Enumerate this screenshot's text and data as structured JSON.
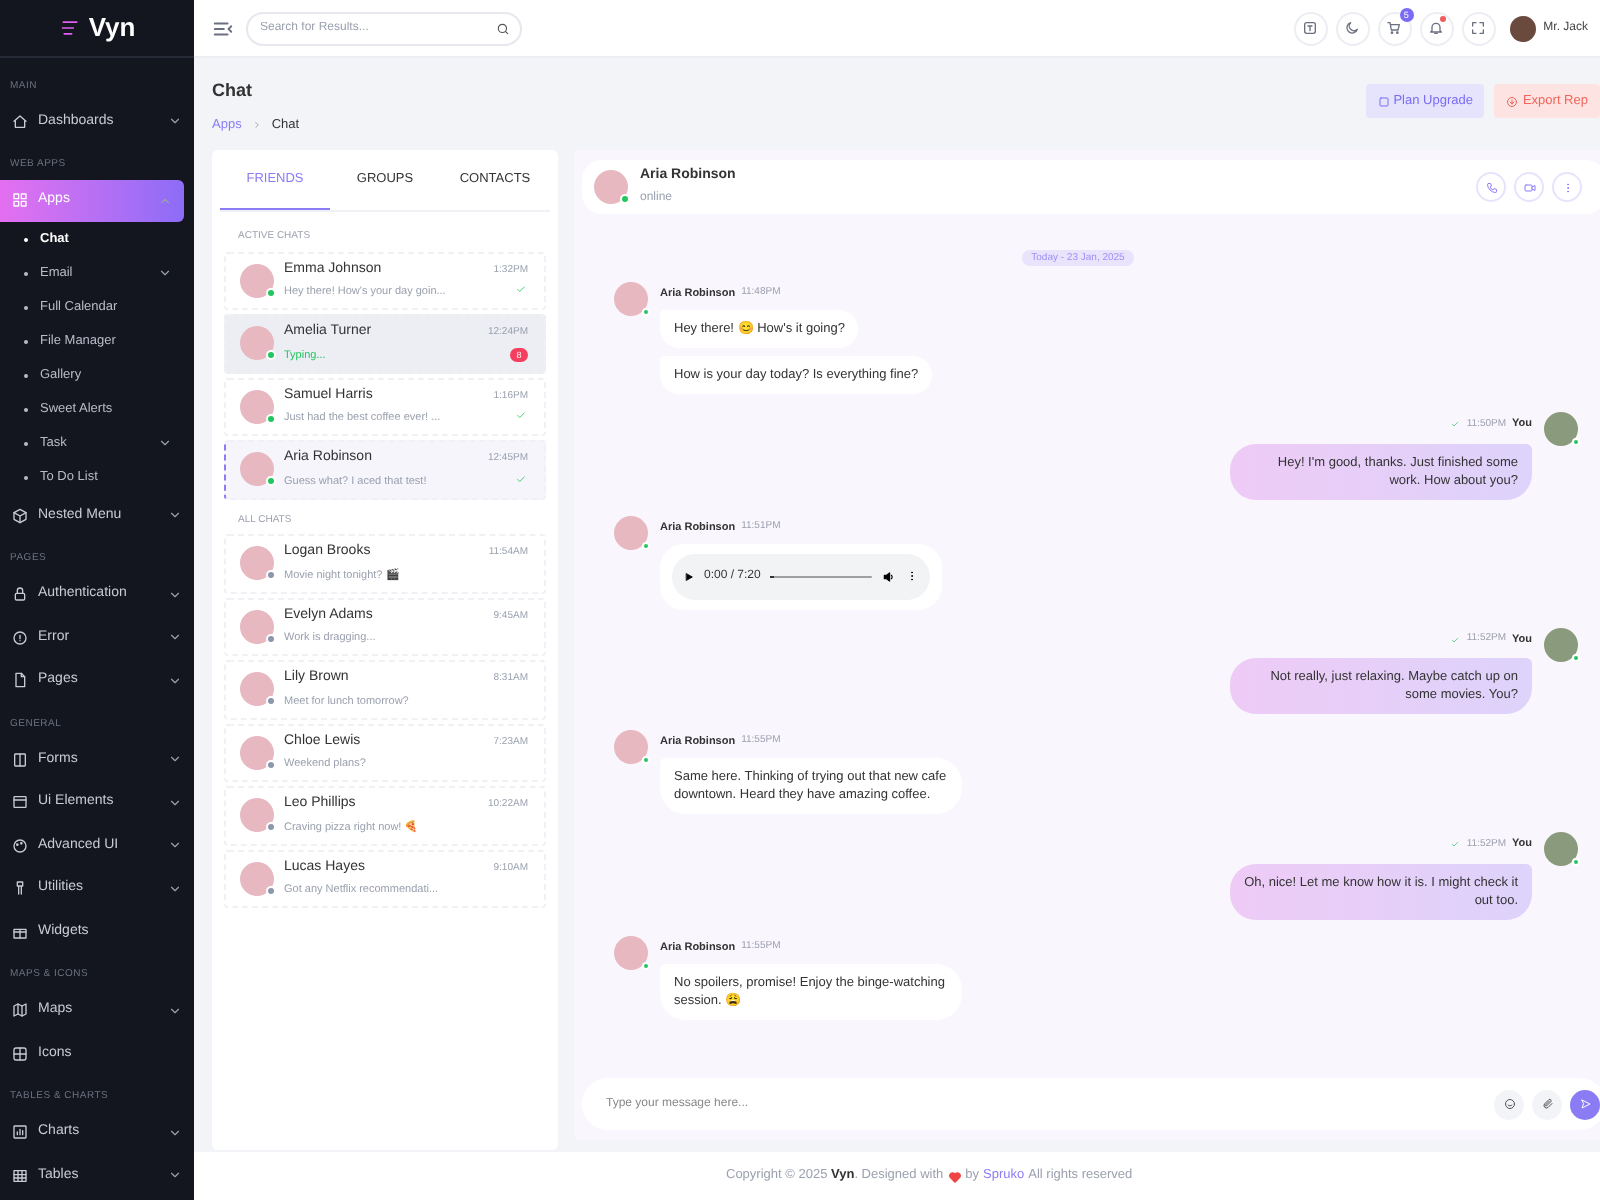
{
  "brand": "Vyn",
  "sidebar": {
    "sections": [
      {
        "label": "MAIN",
        "items": [
          {
            "label": "Dashboards",
            "has_submenu": true,
            "expanded": false,
            "selected": false
          }
        ]
      },
      {
        "label": "WEB APPS",
        "items": [
          {
            "label": "Apps",
            "has_submenu": true,
            "expanded": true,
            "selected": true,
            "children": [
              {
                "label": "Chat",
                "has_submenu": false,
                "selected": true
              },
              {
                "label": "Email",
                "has_submenu": true,
                "selected": false
              },
              {
                "label": "Full Calendar",
                "has_submenu": false,
                "selected": false
              },
              {
                "label": "File Manager",
                "has_submenu": false,
                "selected": false
              },
              {
                "label": "Gallery",
                "has_submenu": false,
                "selected": false
              },
              {
                "label": "Sweet Alerts",
                "has_submenu": false,
                "selected": false
              },
              {
                "label": "Task",
                "has_submenu": true,
                "selected": false
              },
              {
                "label": "To Do List",
                "has_submenu": false,
                "selected": false
              }
            ]
          },
          {
            "label": "Nested Menu",
            "has_submenu": true,
            "expanded": false,
            "selected": false
          }
        ]
      },
      {
        "label": "PAGES",
        "items": [
          {
            "label": "Authentication",
            "has_submenu": true,
            "expanded": false,
            "selected": false
          },
          {
            "label": "Error",
            "has_submenu": true,
            "expanded": false,
            "selected": false
          },
          {
            "label": "Pages",
            "has_submenu": true,
            "expanded": false,
            "selected": false
          }
        ]
      },
      {
        "label": "GENERAL",
        "items": [
          {
            "label": "Forms",
            "has_submenu": true,
            "expanded": false,
            "selected": false
          },
          {
            "label": "Ui Elements",
            "has_submenu": true,
            "expanded": false,
            "selected": false
          },
          {
            "label": "Advanced UI",
            "has_submenu": true,
            "expanded": false,
            "selected": false
          },
          {
            "label": "Utilities",
            "has_submenu": true,
            "expanded": false,
            "selected": false
          },
          {
            "label": "Widgets",
            "has_submenu": false,
            "selected": false
          }
        ]
      },
      {
        "label": "MAPS & ICONS",
        "items": [
          {
            "label": "Maps",
            "has_submenu": true,
            "expanded": false,
            "selected": false
          },
          {
            "label": "Icons",
            "has_submenu": false,
            "selected": false
          }
        ]
      },
      {
        "label": "TABLES & CHARTS",
        "items": [
          {
            "label": "Charts",
            "has_submenu": true,
            "expanded": false,
            "selected": false
          },
          {
            "label": "Tables",
            "has_submenu": true,
            "expanded": false,
            "selected": false
          }
        ]
      }
    ]
  },
  "header": {
    "search": {
      "placeholder": "Search for Results..."
    },
    "cart_count": "5",
    "notifications_unread": true,
    "user": "Mr. Jack"
  },
  "page": {
    "title": "Chat",
    "breadcrumb": [
      "Apps",
      "Chat"
    ],
    "buttons": [
      {
        "label": "Plan Upgrade",
        "kind": "primary"
      },
      {
        "label": "Export Rep",
        "kind": "danger"
      }
    ]
  },
  "chat_list": {
    "tabs": [
      {
        "label": "FRIENDS",
        "selected": true
      },
      {
        "label": "GROUPS",
        "selected": false
      },
      {
        "label": "CONTACTS",
        "selected": false
      }
    ],
    "groups": [
      {
        "label": "ACTIVE CHATS",
        "chats": [
          {
            "name": "Emma Johnson",
            "message": "Hey there! How's your day goin...",
            "time": "1:32PM",
            "online": true,
            "typing": false,
            "read": true,
            "highlighted": false,
            "selected": false
          },
          {
            "name": "Amelia Turner",
            "message": "Typing...",
            "time": "12:24PM",
            "online": true,
            "typing": true,
            "read": false,
            "unread": "8",
            "highlighted": true,
            "selected": false
          },
          {
            "name": "Samuel Harris",
            "message": "Just had the best coffee ever! ...",
            "time": "1:16PM",
            "online": true,
            "typing": false,
            "read": true,
            "highlighted": false,
            "selected": false
          },
          {
            "name": "Aria Robinson",
            "message": "Guess what? I aced that test!",
            "time": "12:45PM",
            "online": true,
            "typing": false,
            "read": true,
            "highlighted": false,
            "selected": true
          }
        ]
      },
      {
        "label": "ALL CHATS",
        "chats": [
          {
            "name": "Logan Brooks",
            "message": "Movie night tonight? 🎬",
            "time": "11:54AM",
            "online": false,
            "typing": false,
            "read": false,
            "highlighted": false,
            "selected": false
          },
          {
            "name": "Evelyn Adams",
            "message": "Work is dragging...",
            "time": "9:45AM",
            "online": false,
            "typing": false,
            "read": false,
            "highlighted": false,
            "selected": false
          },
          {
            "name": "Lily Brown",
            "message": "Meet for lunch tomorrow?",
            "time": "8:31AM",
            "online": false,
            "typing": false,
            "read": false,
            "highlighted": false,
            "selected": false
          },
          {
            "name": "Chloe Lewis",
            "message": "Weekend plans?",
            "time": "7:23AM",
            "online": false,
            "typing": false,
            "read": false,
            "highlighted": false,
            "selected": false
          },
          {
            "name": "Leo Phillips",
            "message": "Craving pizza right now! 🍕",
            "time": "10:22AM",
            "online": false,
            "typing": false,
            "read": false,
            "highlighted": false,
            "selected": false
          },
          {
            "name": "Lucas Hayes",
            "message": "Got any Netflix recommendati...",
            "time": "9:10AM",
            "online": false,
            "typing": false,
            "read": false,
            "highlighted": false,
            "selected": false
          }
        ]
      }
    ]
  },
  "conversation": {
    "contact": {
      "name": "Aria Robinson",
      "status": "online",
      "online": true
    },
    "date": "Today - 23 Jan, 2025",
    "messages": [
      {
        "kind": "received",
        "sender": "Aria Robinson",
        "time": "11:48PM",
        "bubbles": [
          "Hey there! 😊 How's it going?",
          "How is your day today? Is everything fine?"
        ]
      },
      {
        "kind": "sent",
        "sender": "You",
        "time": "11:50PM",
        "read": true,
        "bubbles": [
          "Hey! I'm good, thanks. Just finished some work. How about you?"
        ]
      },
      {
        "kind": "audio",
        "sender": "Aria Robinson",
        "time": "11:51PM",
        "audio": {
          "time": "0:00 / 7:20",
          "level": 0.03
        }
      },
      {
        "kind": "sent",
        "sender": "You",
        "time": "11:52PM",
        "read": true,
        "bubbles": [
          "Not really, just relaxing. Maybe catch up on some movies. You?"
        ]
      },
      {
        "kind": "received",
        "sender": "Aria Robinson",
        "time": "11:55PM",
        "bubbles": [
          "Same here. Thinking of trying out that new cafe downtown. Heard they have amazing coffee."
        ]
      },
      {
        "kind": "sent",
        "sender": "You",
        "time": "11:52PM",
        "read": true,
        "bubbles": [
          "Oh, nice! Let me know how it is. I might check it out too."
        ]
      },
      {
        "kind": "received",
        "sender": "Aria Robinson",
        "time": "11:55PM",
        "bubbles": [
          "No spoilers, promise! Enjoy the binge-watching session. 😩"
        ]
      }
    ],
    "input": {
      "placeholder": "Type your message here..."
    }
  },
  "footer": {
    "before": "Copyright © 2025 **Vyn**. Designed with",
    "by": "by",
    "link": "Spruko",
    "after": "All rights reserved"
  }
}
